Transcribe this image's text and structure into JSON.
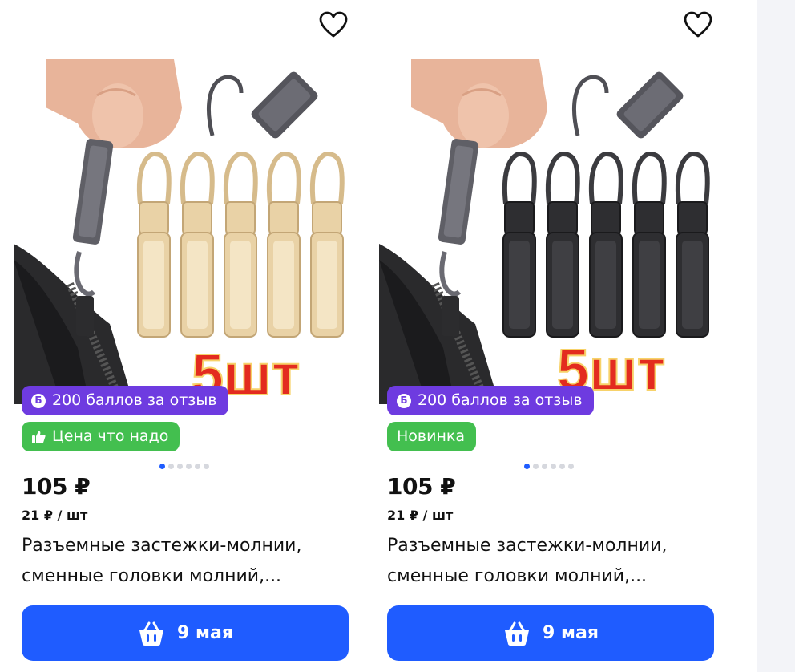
{
  "colors": {
    "accent_blue": "#1f5cff",
    "points_purple": "#6e3be0",
    "promo_green": "#43bf4f"
  },
  "products": [
    {
      "favorite_icon": "heart-outline-icon",
      "image_overlay_text": "5шт",
      "image_variant": "gold",
      "points_badge": "200 баллов за отзыв",
      "promo_badge": "Цена что надо",
      "promo_badge_icon": "thumbs-up-icon",
      "gallery_dots": {
        "total": 6,
        "active": 1
      },
      "price": "105 ₽",
      "unit_price": "21 ₽ / шт",
      "title_line1": "Разъемные застежки-молнии,",
      "title_line2": "сменные головки молний,...",
      "cart_icon": "basket-icon",
      "cart_label": "9 мая"
    },
    {
      "favorite_icon": "heart-outline-icon",
      "image_overlay_text": "5шт",
      "image_variant": "black",
      "points_badge": "200 баллов за отзыв",
      "promo_badge": "Новинка",
      "promo_badge_icon": "",
      "gallery_dots": {
        "total": 6,
        "active": 1
      },
      "price": "105 ₽",
      "unit_price": "21 ₽ / шт",
      "title_line1": "Разъемные застежки-молнии,",
      "title_line2": "сменные головки молний,...",
      "cart_icon": "basket-icon",
      "cart_label": "9 мая"
    }
  ]
}
